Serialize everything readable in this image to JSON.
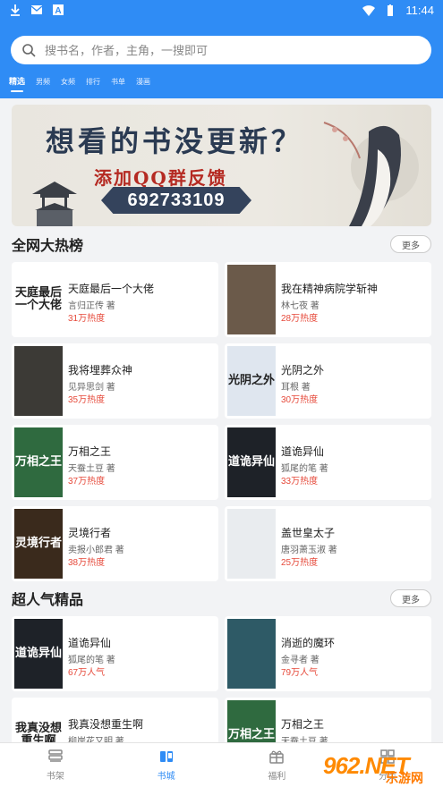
{
  "status": {
    "time": "11:44"
  },
  "search": {
    "placeholder": "搜书名，作者，主角，一搜即可"
  },
  "tabs": [
    "精选",
    "男频",
    "女频",
    "排行",
    "书单",
    "漫画"
  ],
  "banner": {
    "line1": "想看的书没更新？",
    "line2": "添加QQ群反馈",
    "qq": "692733109"
  },
  "hot": {
    "title": "全网大热榜",
    "more": "更多",
    "books": [
      {
        "title": "天庭最后一个大佬",
        "author": "言归正传 著",
        "heat": "31万热度",
        "cover_text": "天庭最后一个大佬",
        "cover_color": "#ffffff"
      },
      {
        "title": "我在精神病院学斩神",
        "author": "林七夜 著",
        "heat": "28万热度",
        "cover_text": "",
        "cover_color": "#6b5a4a"
      },
      {
        "title": "我将埋葬众神",
        "author": "见异思剑 著",
        "heat": "35万热度",
        "cover_text": "",
        "cover_color": "#3c3a36"
      },
      {
        "title": "光阴之外",
        "author": "耳根 著",
        "heat": "30万热度",
        "cover_text": "光阴之外",
        "cover_color": "#dfe6ef"
      },
      {
        "title": "万相之王",
        "author": "天蚕土豆 著",
        "heat": "37万热度",
        "cover_text": "万相之王",
        "cover_color": "#2f6a3f"
      },
      {
        "title": "道诡异仙",
        "author": "狐尾的笔 著",
        "heat": "33万热度",
        "cover_text": "道诡异仙",
        "cover_color": "#1e2228"
      },
      {
        "title": "灵境行者",
        "author": "卖报小郎君 著",
        "heat": "38万热度",
        "cover_text": "灵境行者",
        "cover_color": "#3a2a1c"
      },
      {
        "title": "盖世皇太子",
        "author": "唐羽萧玉淑 著",
        "heat": "25万热度",
        "cover_text": "",
        "cover_color": "#e9ecef"
      }
    ]
  },
  "popular": {
    "title": "超人气精品",
    "more": "更多",
    "books": [
      {
        "title": "道诡异仙",
        "author": "狐尾的笔 著",
        "heat": "67万人气",
        "cover_text": "道诡异仙",
        "cover_color": "#1e2228"
      },
      {
        "title": "消逝的魔环",
        "author": "金寻者 著",
        "heat": "79万人气",
        "cover_text": "",
        "cover_color": "#2e5a66"
      },
      {
        "title": "我真没想重生啊",
        "author": "柳岸花又明 著",
        "heat": "",
        "cover_text": "我真没想重生啊",
        "cover_color": "#ffffff"
      },
      {
        "title": "万相之王",
        "author": "天蚕土豆 著",
        "heat": "",
        "cover_text": "万相之王",
        "cover_color": "#2f6a3f"
      }
    ]
  },
  "nav": [
    "书架",
    "书城",
    "福利",
    "分类"
  ],
  "watermark": {
    "logo": "962.NET",
    "sub": "乐游网"
  }
}
